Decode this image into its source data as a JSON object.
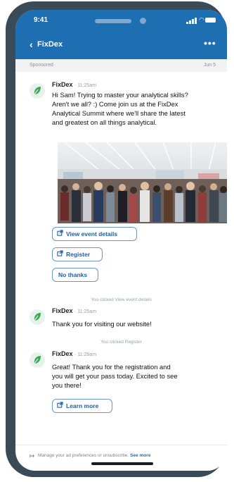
{
  "status": {
    "time": "9:41"
  },
  "nav": {
    "back_label": "FixDex",
    "more_label": "•••"
  },
  "subbar": {
    "sponsored": "Sponsored",
    "date": "Jun 5"
  },
  "messages": [
    {
      "sender": "FixDex",
      "time": "11:25am",
      "lines": [
        "Hi Sam! Trying to master your analytical skills?",
        "Aren't we all? :) Come join us at the FixDex",
        "Analytical Summit where we'll share the latest",
        "and greatest on all things analytical."
      ]
    },
    {
      "sender": "FixDex",
      "time": "11:25am",
      "text": "Thank you for visiting our website!"
    },
    {
      "sender": "FixDex",
      "time": "11:29am",
      "lines": [
        "Great! Thank you for the registration and",
        "you will get your pass today. Excited to see",
        "you there!"
      ]
    }
  ],
  "buttons": {
    "view_event": "View event details",
    "register": "Register",
    "no_thanks": "No thanks",
    "learn_more": "Learn more"
  },
  "system": {
    "clicked_view": "You clicked View event details",
    "clicked_register": "You clicked Register"
  },
  "footer": {
    "text": "Manage your ad preferences or unsubscribe.",
    "link": "See more"
  },
  "colors": {
    "brand": "#1d6fb2",
    "button_border": "#6b95c9",
    "avatar": "#3aa95a"
  },
  "icons": [
    "chevron-left-icon",
    "more-icon",
    "external-link-icon",
    "leaf-logo-icon",
    "manage-preferences-icon"
  ]
}
